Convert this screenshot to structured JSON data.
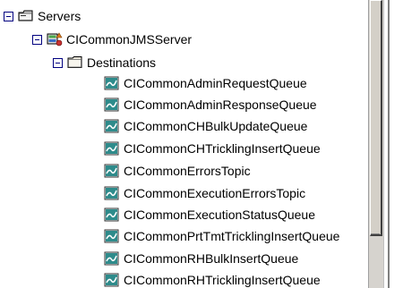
{
  "tree": {
    "root": {
      "label": "Servers",
      "icon": "server-group-icon",
      "expanded": true
    },
    "server": {
      "label": "CICommonJMSServer",
      "icon": "jms-server-icon",
      "expanded": true
    },
    "destinations": {
      "label": "Destinations",
      "icon": "folder-icon",
      "expanded": true
    },
    "queues": [
      {
        "label": "CICommonAdminRequestQueue"
      },
      {
        "label": "CICommonAdminResponseQueue"
      },
      {
        "label": "CICommonCHBulkUpdateQueue"
      },
      {
        "label": "CICommonCHTricklingInsertQueue"
      },
      {
        "label": "CICommonErrorsTopic"
      },
      {
        "label": "CICommonExecutionErrorsTopic"
      },
      {
        "label": "CICommonExecutionStatusQueue"
      },
      {
        "label": "CICommonPrtTmtTricklingInsertQueue"
      },
      {
        "label": "CICommonRHBulkInsertQueue"
      },
      {
        "label": "CICommonRHTricklingInsertQueue"
      }
    ]
  },
  "colors": {
    "tree_line": "#000080",
    "folder_fill": "#e8e4d8",
    "queue_icon_fill": "#2e8b8b",
    "scrollbar": "#d4d0c8"
  }
}
